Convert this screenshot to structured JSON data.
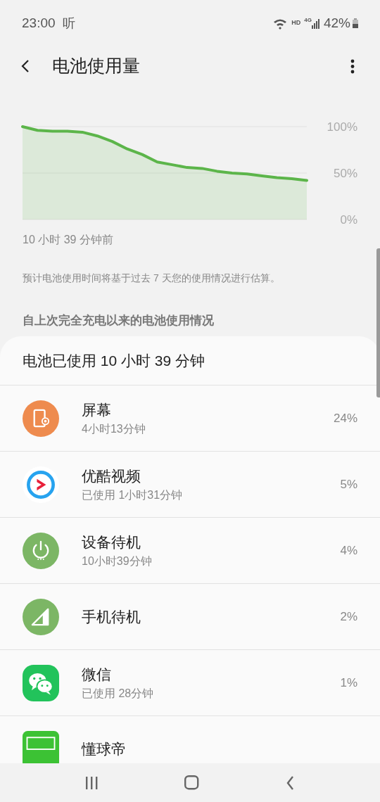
{
  "status_bar": {
    "time": "23:00",
    "notification": "听",
    "network_hd": "HD",
    "network_type": "4G",
    "battery": "42%"
  },
  "header": {
    "title": "电池使用量"
  },
  "chart": {
    "chart_data": {
      "type": "area",
      "categories": [
        null,
        null,
        null,
        null,
        null,
        null,
        null,
        null,
        null,
        null,
        null,
        null,
        null,
        null,
        null,
        null,
        null,
        null,
        null,
        null
      ],
      "ylim": [
        0,
        100
      ],
      "yticks": [
        {
          "value": 100,
          "label": "100%"
        },
        {
          "value": 50,
          "label": "50%"
        },
        {
          "value": 0,
          "label": "0%"
        }
      ],
      "series": [
        {
          "color": "#5cb54a",
          "values": [
            100,
            96,
            95,
            95,
            94,
            90,
            84,
            76,
            70,
            62,
            59,
            56,
            55,
            52,
            50,
            49,
            47,
            45,
            44,
            42
          ]
        }
      ]
    },
    "start_label": "10 小时 39 分钟前"
  },
  "note": "预计电池使用时间将基于过去 7 天您的使用情况进行估算。",
  "section_title": "自上次完全充电以来的电池使用情况",
  "usage": {
    "title": "电池已使用 10 小时 39 分钟",
    "items": [
      {
        "kind": "screen",
        "name": "屏幕",
        "detail": "4小时13分钟",
        "percent": "24%"
      },
      {
        "kind": "video",
        "name": "优酷视频",
        "detail": "已使用 1小时31分钟",
        "percent": "5%"
      },
      {
        "kind": "power",
        "name": "设备待机",
        "detail": "10小时39分钟",
        "percent": "4%"
      },
      {
        "kind": "signal",
        "name": "手机待机",
        "percent": "2%"
      },
      {
        "kind": "chat",
        "name": "微信",
        "detail": "已使用 28分钟",
        "percent": "1%"
      },
      {
        "kind": "sport",
        "name": "懂球帝"
      }
    ]
  }
}
